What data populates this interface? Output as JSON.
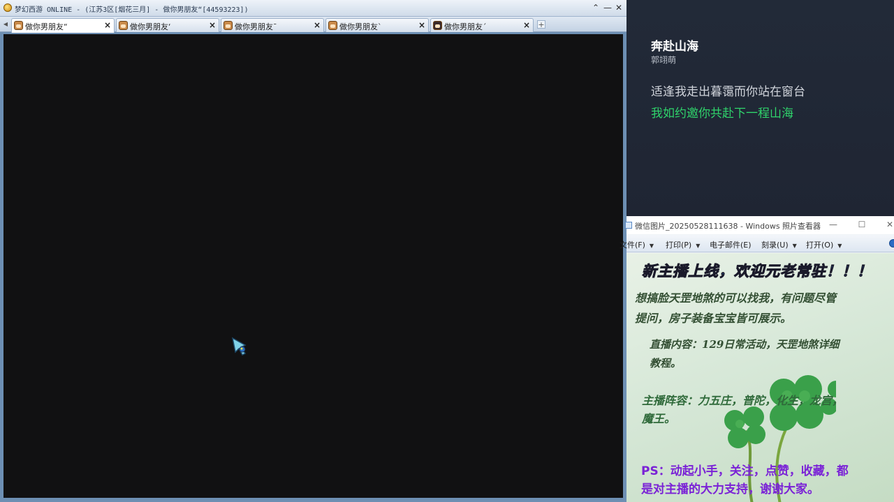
{
  "game_window": {
    "title": "梦幻西游 ONLINE - (江苏3区[烟花三月] - 做你男朋友“[44593223])",
    "window_controls": {
      "restore": "⌃",
      "minimize": "—",
      "close": "✕"
    },
    "tabs": [
      {
        "label": "做你男朋友“",
        "active": true
      },
      {
        "label": "做你男朋友‘",
        "active": false
      },
      {
        "label": "做你男朋友¯",
        "active": false
      },
      {
        "label": "做你男朋友`",
        "active": false
      },
      {
        "label": "做你男朋友´",
        "active": false
      }
    ],
    "tab_close_glyph": "×",
    "add_tab_glyph": "+"
  },
  "music": {
    "song_title": "奔赴山海",
    "artist": "郭翊萌",
    "lyric_current": "适逢我走出暮霭而你站在窗台",
    "lyric_highlight": "我如约邀你共赴下一程山海",
    "highlight_color": "#2fd36b"
  },
  "photo_viewer": {
    "title": "微信图片_20250528111638 - Windows 照片查看器",
    "controls": {
      "minimize": "—",
      "maximize": "☐",
      "close": "✕"
    },
    "menu": [
      {
        "label": "文件(F)"
      },
      {
        "label": "打印(P)"
      },
      {
        "label": "电子邮件(E)"
      },
      {
        "label": "刻录(U)"
      },
      {
        "label": "打开(O)"
      }
    ],
    "poster": {
      "headline": "新主播上线，欢迎元老常驻！！！",
      "intro_line1": "想搞脸天罡地煞的可以找我，有问题尽管",
      "intro_line2": "提问，房子装备宝宝皆可展示。",
      "content_line1": "直播内容：129日常活动，天罡地煞详细",
      "content_line2": "教程。",
      "roles_line1": "主播阵容：力五庄，普陀，化生，龙宫，",
      "roles_line2": "魔王。",
      "ps_line1": "PS：动起小手，关注，点赞，收藏，都",
      "ps_line2": "是对主播的大力支持，谢谢大家。"
    }
  }
}
